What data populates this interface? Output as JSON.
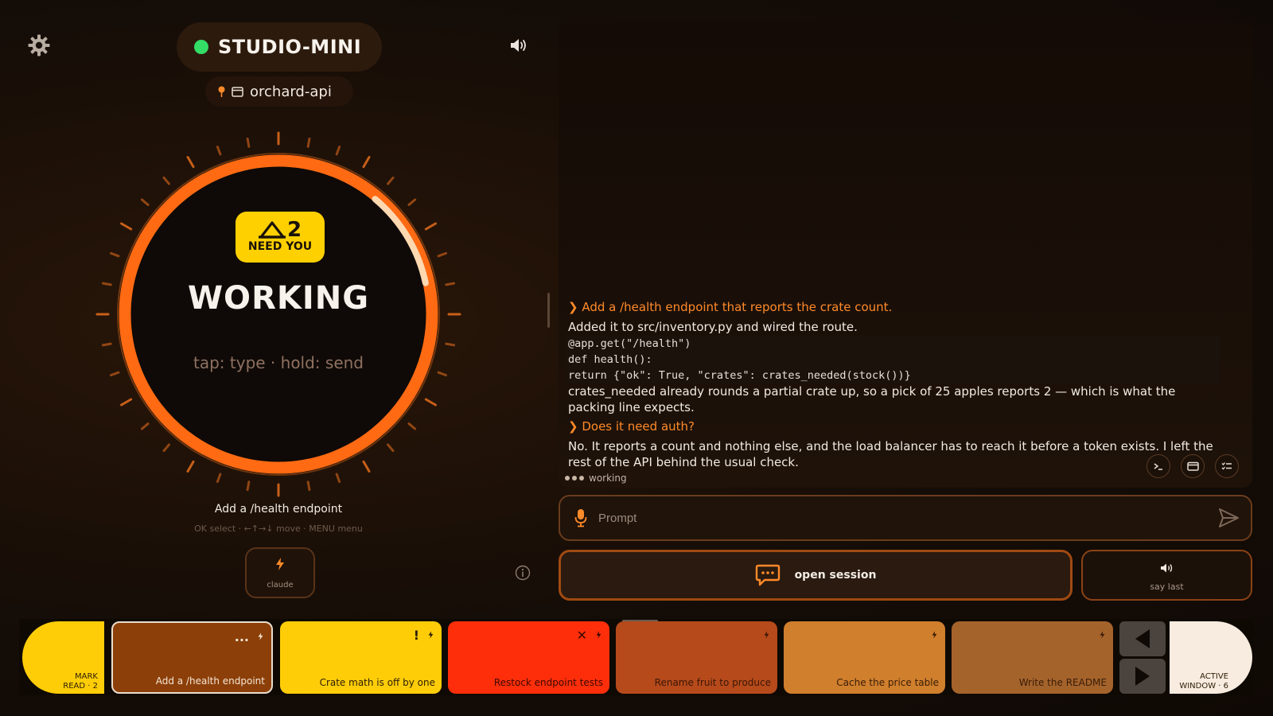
{
  "header": {
    "device_name": "STUDIO-MINI",
    "device_status_color": "#33dd66",
    "project_name": "orchard-api",
    "settings_icon": "gear-icon",
    "speaker_icon": "speaker-icon"
  },
  "dial": {
    "need_count": "2",
    "need_label": "NEED YOU",
    "state": "WORKING",
    "hint": "tap: type · hold: send",
    "accent_color": "#ff6a13",
    "badge_color": "#ffd000"
  },
  "task": {
    "title": "Add a /health endpoint",
    "nav_hint": "OK select · ←↑→↓ move · MENU menu"
  },
  "agent": {
    "label": "claude",
    "icon": "bolt-icon"
  },
  "transcript": {
    "messages": [
      {
        "prompt": "Add a /health endpoint that reports the crate count."
      },
      {
        "text": "Added it to src/inventory.py and wired the route."
      },
      {
        "code": [
          "@app.get(\"/health\")",
          "def health():",
          "return {\"ok\": True, \"crates\": crates_needed(stock())}"
        ]
      },
      {
        "text": "crates_needed already rounds a partial crate up, so a pick of 25 apples reports 2 — which is what the packing line expects."
      },
      {
        "prompt": "Does it need auth?"
      },
      {
        "text": "No. It reports a count and nothing else, and the load balancer has to reach it before a token exists. I left the rest of the API behind the usual check."
      }
    ],
    "status": "working"
  },
  "prompt": {
    "placeholder": "Prompt"
  },
  "actions": {
    "open_session": "open session",
    "say_last": "say last"
  },
  "sessions": {
    "mark_read": {
      "line1": "MARK",
      "line2": "READ · 2"
    },
    "cards": [
      {
        "title": "Add a /health endpoint",
        "mark": "...",
        "status": "selected"
      },
      {
        "title": "Crate math is off by one",
        "mark": "!",
        "status": "needs-attention"
      },
      {
        "title": "Restock endpoint tests",
        "mark": "✕",
        "status": "failed"
      },
      {
        "title": "Rename fruit to produce",
        "mark": "",
        "status": "idle"
      },
      {
        "title": "Cache the price table",
        "mark": "",
        "status": "idle"
      },
      {
        "title": "Write the README",
        "mark": "",
        "status": "idle"
      }
    ],
    "active_window": {
      "line1": "ACTIVE",
      "line2": "WINDOW · 6"
    }
  }
}
